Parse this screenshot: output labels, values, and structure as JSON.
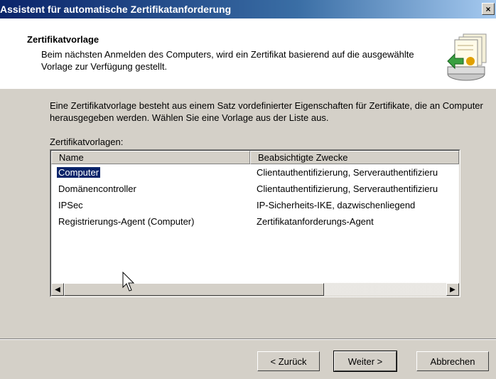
{
  "window": {
    "title": "Assistent für automatische Zertifikatanforderung",
    "close_glyph": "×"
  },
  "header": {
    "title": "Zertifikatvorlage",
    "subtitle": "Beim nächsten Anmelden des Computers, wird ein Zertifikat basierend auf die ausgewählte Vorlage zur Verfügung gestellt.",
    "icon": "certificate-icon"
  },
  "body": {
    "intro": "Eine Zertifikatvorlage besteht aus einem Satz vordefinierter Eigenschaften für Zertifikate, die an Computer herausgegeben werden. Wählen Sie eine Vorlage aus der Liste aus.",
    "list_label": "Zertifikatvorlagen:"
  },
  "list": {
    "columns": [
      "Name",
      "Beabsichtigte Zwecke"
    ],
    "rows": [
      {
        "name": "Computer",
        "purpose": "Clientauthentifizierung, Serverauthentifizieru",
        "selected": true
      },
      {
        "name": "Domänencontroller",
        "purpose": "Clientauthentifizierung, Serverauthentifizieru",
        "selected": false
      },
      {
        "name": "IPSec",
        "purpose": "IP-Sicherheits-IKE, dazwischenliegend",
        "selected": false
      },
      {
        "name": "Registrierungs-Agent (Computer)",
        "purpose": "Zertifikatanforderungs-Agent",
        "selected": false
      }
    ]
  },
  "buttons": {
    "back": "< Zurück",
    "next": "Weiter >",
    "cancel": "Abbrechen"
  },
  "colors": {
    "selection": "#0a246a",
    "titlebar": "#0a246a",
    "face": "#d4d0c8"
  }
}
